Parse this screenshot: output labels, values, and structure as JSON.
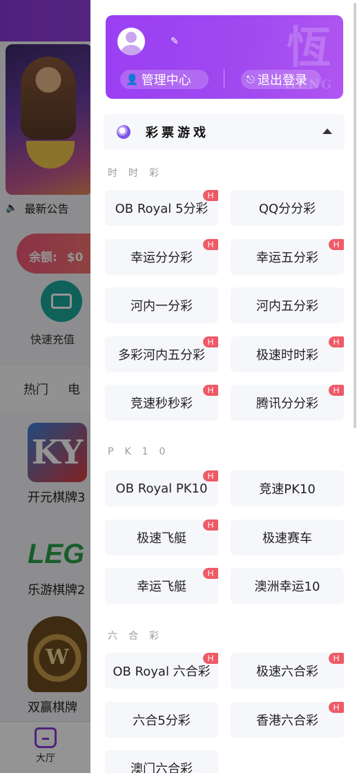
{
  "background": {
    "notice_label": "最新公告",
    "balance_label": "余额:",
    "balance_value": "$0",
    "recharge_label": "快速充值",
    "tabs": [
      "热门",
      "电"
    ],
    "games": [
      {
        "name": "开元棋牌3",
        "logo_text": "KY"
      },
      {
        "name": "乐游棋牌2",
        "logo_text": "LEG"
      },
      {
        "name": "双赢棋牌",
        "logo_text": "W"
      }
    ],
    "bottom_nav": {
      "home_label": "大厅"
    }
  },
  "drawer": {
    "user_card": {
      "manage_label": "管理中心",
      "logout_label": "退出登录",
      "seal_text": "恆",
      "seal_subtext": "HENG"
    },
    "section_title": "彩票游戏",
    "hot_badge": "H",
    "groups": [
      {
        "label": "时时彩",
        "items": [
          {
            "label": "OB Royal 5分彩",
            "hot": true
          },
          {
            "label": "QQ分分彩",
            "hot": false
          },
          {
            "label": "幸运分分彩",
            "hot": true
          },
          {
            "label": "幸运五分彩",
            "hot": true
          },
          {
            "label": "河内一分彩",
            "hot": false
          },
          {
            "label": "河内五分彩",
            "hot": false
          },
          {
            "label": "多彩河内五分彩",
            "hot": true
          },
          {
            "label": "极速时时彩",
            "hot": true
          },
          {
            "label": "竞速秒秒彩",
            "hot": true
          },
          {
            "label": "腾讯分分彩",
            "hot": true
          }
        ]
      },
      {
        "label": "PK10",
        "items": [
          {
            "label": "OB Royal PK10",
            "hot": true
          },
          {
            "label": "竞速PK10",
            "hot": false
          },
          {
            "label": "极速飞艇",
            "hot": true
          },
          {
            "label": "极速赛车",
            "hot": false
          },
          {
            "label": "幸运飞艇",
            "hot": true
          },
          {
            "label": "澳洲幸运10",
            "hot": false
          }
        ]
      },
      {
        "label": "六合彩",
        "items": [
          {
            "label": "OB Royal 六合彩",
            "hot": true
          },
          {
            "label": "极速六合彩",
            "hot": true
          },
          {
            "label": "六合5分彩",
            "hot": false
          },
          {
            "label": "香港六合彩",
            "hot": true
          },
          {
            "label": "澳门六合彩",
            "hot": false
          }
        ]
      }
    ]
  }
}
